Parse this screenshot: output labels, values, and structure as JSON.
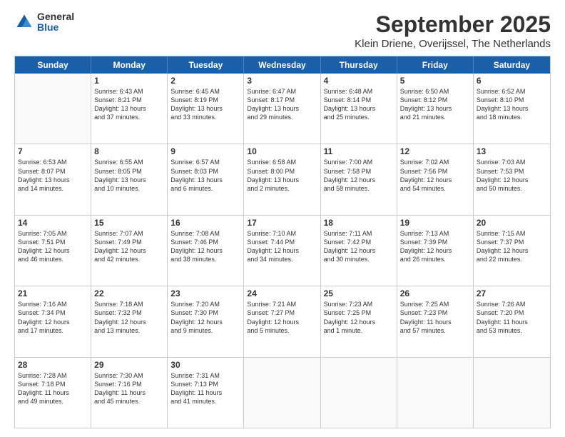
{
  "header": {
    "logo_general": "General",
    "logo_blue": "Blue",
    "month": "September 2025",
    "location": "Klein Driene, Overijssel, The Netherlands"
  },
  "days_of_week": [
    "Sunday",
    "Monday",
    "Tuesday",
    "Wednesday",
    "Thursday",
    "Friday",
    "Saturday"
  ],
  "weeks": [
    [
      {
        "day": "",
        "info": ""
      },
      {
        "day": "1",
        "info": "Sunrise: 6:43 AM\nSunset: 8:21 PM\nDaylight: 13 hours\nand 37 minutes."
      },
      {
        "day": "2",
        "info": "Sunrise: 6:45 AM\nSunset: 8:19 PM\nDaylight: 13 hours\nand 33 minutes."
      },
      {
        "day": "3",
        "info": "Sunrise: 6:47 AM\nSunset: 8:17 PM\nDaylight: 13 hours\nand 29 minutes."
      },
      {
        "day": "4",
        "info": "Sunrise: 6:48 AM\nSunset: 8:14 PM\nDaylight: 13 hours\nand 25 minutes."
      },
      {
        "day": "5",
        "info": "Sunrise: 6:50 AM\nSunset: 8:12 PM\nDaylight: 13 hours\nand 21 minutes."
      },
      {
        "day": "6",
        "info": "Sunrise: 6:52 AM\nSunset: 8:10 PM\nDaylight: 13 hours\nand 18 minutes."
      }
    ],
    [
      {
        "day": "7",
        "info": "Sunrise: 6:53 AM\nSunset: 8:07 PM\nDaylight: 13 hours\nand 14 minutes."
      },
      {
        "day": "8",
        "info": "Sunrise: 6:55 AM\nSunset: 8:05 PM\nDaylight: 13 hours\nand 10 minutes."
      },
      {
        "day": "9",
        "info": "Sunrise: 6:57 AM\nSunset: 8:03 PM\nDaylight: 13 hours\nand 6 minutes."
      },
      {
        "day": "10",
        "info": "Sunrise: 6:58 AM\nSunset: 8:00 PM\nDaylight: 13 hours\nand 2 minutes."
      },
      {
        "day": "11",
        "info": "Sunrise: 7:00 AM\nSunset: 7:58 PM\nDaylight: 12 hours\nand 58 minutes."
      },
      {
        "day": "12",
        "info": "Sunrise: 7:02 AM\nSunset: 7:56 PM\nDaylight: 12 hours\nand 54 minutes."
      },
      {
        "day": "13",
        "info": "Sunrise: 7:03 AM\nSunset: 7:53 PM\nDaylight: 12 hours\nand 50 minutes."
      }
    ],
    [
      {
        "day": "14",
        "info": "Sunrise: 7:05 AM\nSunset: 7:51 PM\nDaylight: 12 hours\nand 46 minutes."
      },
      {
        "day": "15",
        "info": "Sunrise: 7:07 AM\nSunset: 7:49 PM\nDaylight: 12 hours\nand 42 minutes."
      },
      {
        "day": "16",
        "info": "Sunrise: 7:08 AM\nSunset: 7:46 PM\nDaylight: 12 hours\nand 38 minutes."
      },
      {
        "day": "17",
        "info": "Sunrise: 7:10 AM\nSunset: 7:44 PM\nDaylight: 12 hours\nand 34 minutes."
      },
      {
        "day": "18",
        "info": "Sunrise: 7:11 AM\nSunset: 7:42 PM\nDaylight: 12 hours\nand 30 minutes."
      },
      {
        "day": "19",
        "info": "Sunrise: 7:13 AM\nSunset: 7:39 PM\nDaylight: 12 hours\nand 26 minutes."
      },
      {
        "day": "20",
        "info": "Sunrise: 7:15 AM\nSunset: 7:37 PM\nDaylight: 12 hours\nand 22 minutes."
      }
    ],
    [
      {
        "day": "21",
        "info": "Sunrise: 7:16 AM\nSunset: 7:34 PM\nDaylight: 12 hours\nand 17 minutes."
      },
      {
        "day": "22",
        "info": "Sunrise: 7:18 AM\nSunset: 7:32 PM\nDaylight: 12 hours\nand 13 minutes."
      },
      {
        "day": "23",
        "info": "Sunrise: 7:20 AM\nSunset: 7:30 PM\nDaylight: 12 hours\nand 9 minutes."
      },
      {
        "day": "24",
        "info": "Sunrise: 7:21 AM\nSunset: 7:27 PM\nDaylight: 12 hours\nand 5 minutes."
      },
      {
        "day": "25",
        "info": "Sunrise: 7:23 AM\nSunset: 7:25 PM\nDaylight: 12 hours\nand 1 minute."
      },
      {
        "day": "26",
        "info": "Sunrise: 7:25 AM\nSunset: 7:23 PM\nDaylight: 11 hours\nand 57 minutes."
      },
      {
        "day": "27",
        "info": "Sunrise: 7:26 AM\nSunset: 7:20 PM\nDaylight: 11 hours\nand 53 minutes."
      }
    ],
    [
      {
        "day": "28",
        "info": "Sunrise: 7:28 AM\nSunset: 7:18 PM\nDaylight: 11 hours\nand 49 minutes."
      },
      {
        "day": "29",
        "info": "Sunrise: 7:30 AM\nSunset: 7:16 PM\nDaylight: 11 hours\nand 45 minutes."
      },
      {
        "day": "30",
        "info": "Sunrise: 7:31 AM\nSunset: 7:13 PM\nDaylight: 11 hours\nand 41 minutes."
      },
      {
        "day": "",
        "info": ""
      },
      {
        "day": "",
        "info": ""
      },
      {
        "day": "",
        "info": ""
      },
      {
        "day": "",
        "info": ""
      }
    ]
  ]
}
